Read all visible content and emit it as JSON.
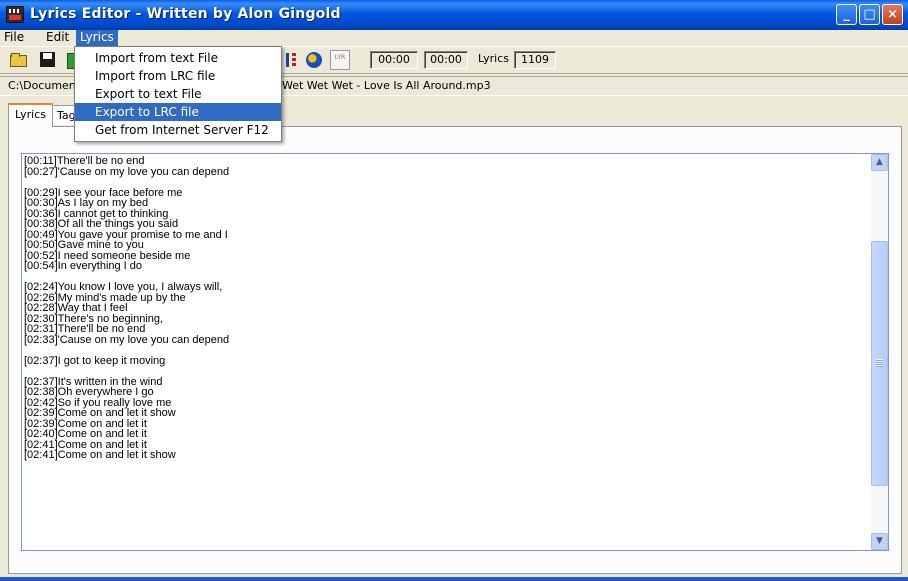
{
  "window": {
    "title": "Lyrics Editor - Written by Alon Gingold",
    "minimize": "_",
    "maximize": "□",
    "close": "×"
  },
  "menubar": {
    "file": "File",
    "edit": "Edit",
    "lyrics": "Lyrics"
  },
  "lyrics_menu": {
    "items": [
      "Import from text File",
      "Import from LRC file",
      "Export to text File",
      "Export to LRC file",
      "Get from Internet Server  F12"
    ],
    "highlighted_index": 3
  },
  "toolbar": {
    "lyr_label": "LYR",
    "time_current": "00:00",
    "time_total": "00:00",
    "lyrics_label": "Lyrics",
    "lyrics_count": "1109"
  },
  "path": {
    "left": "C:\\Document",
    "right": "Wet Wet Wet - Love Is All Around.mp3"
  },
  "tabs": {
    "lyrics": "Lyrics",
    "tag": "Tag"
  },
  "lyrics_text": "[00:11]There'll be no end\n[00:27]'Cause on my love you can depend\n\n[00:29]I see your face before me\n[00:30]As I lay on my bed\n[00:36]I cannot get to thinking\n[00:38]Of all the things you said\n[00:49]You gave your promise to me and I\n[00:50]Gave mine to you\n[00:52]I need someone beside me\n[00:54]In everything I do\n\n[02:24]You know I love you, I always will,\n[02:26]My mind's made up by the\n[02:28]Way that I feel\n[02:30]There's no beginning,\n[02:31]There'll be no end\n[02:33]'Cause on my love you can depend\n\n[02:37]I got to keep it moving\n\n[02:37]It's written in the wind\n[02:38]Oh everywhere I go\n[02:42]So if you really love me\n[02:39]Come on and let it show\n[02:39]Come on and let it\n[02:40]Come on and let it\n[02:41]Come on and let it\n[02:41]Come on and let it show",
  "scroll_position": 0.6
}
